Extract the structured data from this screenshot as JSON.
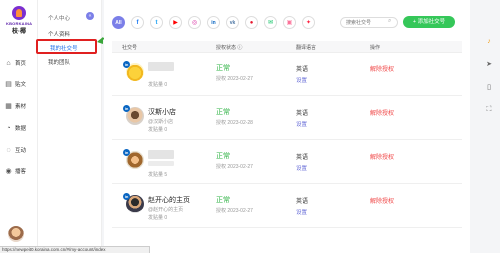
{
  "brand": {
    "name": "KBORKAINA",
    "name_cn": "枝·椰"
  },
  "nav": {
    "items": [
      {
        "label": "首页",
        "icon": "home-icon"
      },
      {
        "label": "贴文",
        "icon": "post-icon"
      },
      {
        "label": "素材",
        "icon": "material-icon"
      },
      {
        "label": "数据",
        "icon": "chart-icon"
      },
      {
        "label": "互动",
        "icon": "chat-icon"
      },
      {
        "label": "播客",
        "icon": "podcast-icon"
      }
    ]
  },
  "subnav": {
    "section": "个人中心",
    "items": [
      "个人资料",
      "我的社交号",
      "我的团队"
    ],
    "collapse_glyph": "«"
  },
  "toolbar": {
    "platforms": [
      {
        "label": "All",
        "icon": "all-platforms-icon",
        "color": "#7b7fe8"
      },
      {
        "label": "f",
        "icon": "facebook-icon",
        "color": "#1877f2"
      },
      {
        "label": "t",
        "icon": "twitter-icon",
        "color": "#1da1f2"
      },
      {
        "label": "▶",
        "icon": "youtube-icon",
        "color": "#ff0000"
      },
      {
        "label": "◎",
        "icon": "instagram-icon",
        "color": "#d6249f"
      },
      {
        "label": "in",
        "icon": "linkedin-icon",
        "color": "#0a66c2"
      },
      {
        "label": "vk",
        "icon": "vk-icon",
        "color": "#4c75a3"
      },
      {
        "label": "●",
        "icon": "weibo-icon",
        "color": "#e6162d"
      },
      {
        "label": "✉",
        "icon": "wechat-icon",
        "color": "#07c160"
      },
      {
        "label": "▣",
        "icon": "bilibili-icon",
        "color": "#fb7299"
      },
      {
        "label": "✦",
        "icon": "xiaohongshu-icon",
        "color": "#ff2442"
      }
    ],
    "search_placeholder": "搜索社交号",
    "add_label": "+ 添加社交号"
  },
  "table": {
    "headers": {
      "account": "社交号",
      "auth": "授权状态 ⓘ",
      "lang": "翻译语言",
      "op": "操作"
    },
    "rows": [
      {
        "name": "",
        "sub": "发贴量 0",
        "status": "正常",
        "date": "授权 2023-02-27",
        "lang": "英语",
        "setting": "设置",
        "action": "解除授权",
        "avatar": "avatar-pikachu",
        "hidden": true
      },
      {
        "name": "汉斯小店",
        "handle": "@汉斯小店",
        "sub": "发贴量 0",
        "status": "正常",
        "date": "授权 2023-02-28",
        "lang": "英语",
        "setting": "设置",
        "action": "解除授权",
        "avatar": "avatar-cartoon",
        "hidden": false
      },
      {
        "name": "",
        "sub": "发贴量 5",
        "status": "正常",
        "date": "授权 2023-02-27",
        "lang": "英语",
        "setting": "设置",
        "action": "解除授权",
        "avatar": "avatar-monkey",
        "hidden": true
      },
      {
        "name": "赵开心的主页",
        "handle": "@赵开心的主页",
        "sub": "发贴量 0",
        "status": "正常",
        "date": "授权 2023-02-27",
        "lang": "英语",
        "setting": "设置",
        "action": "解除授权",
        "avatar": "avatar-person",
        "hidden": false
      }
    ]
  },
  "statusbar": "https://newpeit0.koraina.com.cn/#/my-account/index"
}
